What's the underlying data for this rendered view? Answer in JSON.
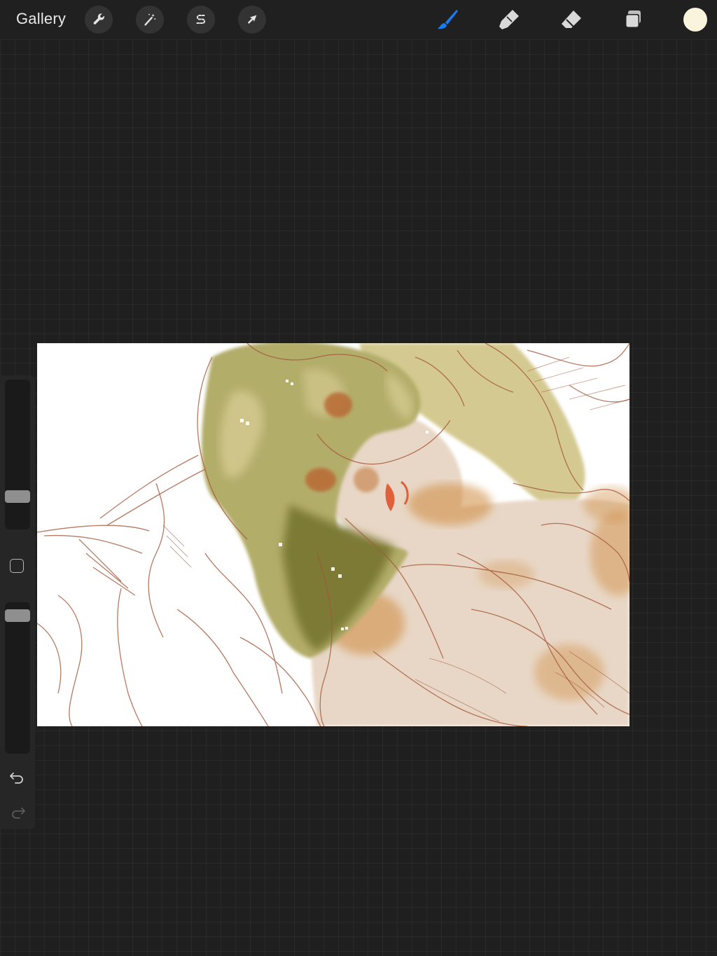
{
  "toolbar": {
    "gallery_label": "Gallery",
    "left_tools": [
      {
        "name": "actions",
        "icon": "wrench-icon"
      },
      {
        "name": "adjustments",
        "icon": "magic-wand-icon"
      },
      {
        "name": "selection",
        "icon": "selection-s-icon"
      },
      {
        "name": "transform",
        "icon": "arrow-cursor-icon"
      }
    ],
    "right_tools": [
      {
        "name": "brush",
        "icon": "brush-icon",
        "active": true
      },
      {
        "name": "smudge",
        "icon": "smudge-finger-icon",
        "active": false
      },
      {
        "name": "eraser",
        "icon": "eraser-icon",
        "active": false
      },
      {
        "name": "layers",
        "icon": "layers-icon",
        "active": false
      }
    ],
    "current_color": "#fbf4dc",
    "active_accent": "#1a7cf5"
  },
  "sidebar": {
    "brush_size": 0.18,
    "brush_opacity": 0.97,
    "undo_icon": "undo-arrow-icon",
    "redo_icon": "redo-arrow-icon",
    "modify_icon": "square-modify-icon"
  },
  "canvas": {
    "artwork": "sketch-illustration",
    "palette": {
      "hair": "#b3ad6a",
      "hair_dark": "#7c7a34",
      "hair_light": "#d4c990",
      "skin": "#e8d7c6",
      "shadow": "#cf8a3e",
      "line": "#a4583a",
      "eye": "#b96a35",
      "lips": "#e0603a"
    }
  }
}
